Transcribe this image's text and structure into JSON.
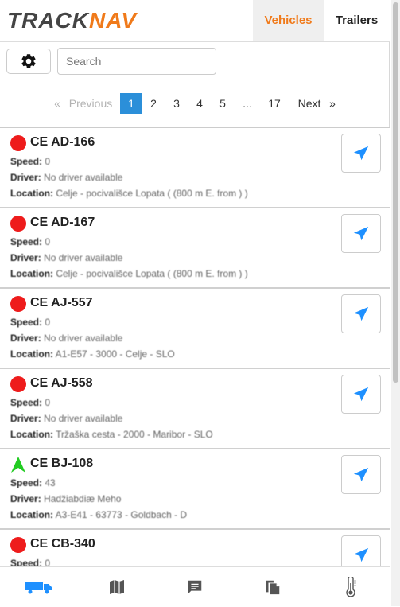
{
  "header": {
    "logo_part1": "TRACK",
    "logo_part2": "NAV",
    "tabs": [
      {
        "label": "Vehicles",
        "active": true
      },
      {
        "label": "Trailers",
        "active": false
      }
    ]
  },
  "toolbar": {
    "settings_icon": "gear-icon",
    "search_placeholder": "Search",
    "search_value": ""
  },
  "pagination": {
    "prev_arrow": "«",
    "previous": "Previous",
    "pages": [
      "1",
      "2",
      "3",
      "4",
      "5",
      "...",
      "17"
    ],
    "current_page": "1",
    "next": "Next",
    "next_arrow": "»"
  },
  "labels": {
    "speed": "Speed:",
    "driver": "Driver:",
    "location": "Location:"
  },
  "vehicles": [
    {
      "plate": "CE AD-166",
      "status": "stopped",
      "speed": "0",
      "driver": "No driver available",
      "location": "Celje - pocivališce Lopata ( (800 m E. from ) )"
    },
    {
      "plate": "CE AD-167",
      "status": "stopped",
      "speed": "0",
      "driver": "No driver available",
      "location": "Celje - pocivališce Lopata ( (800 m E. from ) )"
    },
    {
      "plate": "CE AJ-557",
      "status": "stopped",
      "speed": "0",
      "driver": "No driver available",
      "location": "A1-E57 - 3000 - Celje - SLO"
    },
    {
      "plate": "CE AJ-558",
      "status": "stopped",
      "speed": "0",
      "driver": "No driver available",
      "location": "Tržaška cesta - 2000 - Maribor - SLO"
    },
    {
      "plate": "CE BJ-108",
      "status": "moving",
      "speed": "43",
      "driver": "Hadžiabdiæ Meho",
      "location": "A3-E41 - 63773 - Goldbach - D"
    },
    {
      "plate": "CE CB-340",
      "status": "stopped",
      "speed": "0",
      "driver": "",
      "location": ""
    }
  ],
  "bottom_nav": [
    {
      "icon": "truck-icon",
      "active": true
    },
    {
      "icon": "map-icon",
      "active": false
    },
    {
      "icon": "message-icon",
      "active": false
    },
    {
      "icon": "documents-icon",
      "active": false
    },
    {
      "icon": "thermometer-icon",
      "active": false
    }
  ],
  "colors": {
    "accent": "#f07a1a",
    "active_page": "#2b8fd9",
    "nav_arrow": "#1e90ff",
    "status_stopped": "#ee1c1c",
    "status_moving": "#22cc22"
  }
}
